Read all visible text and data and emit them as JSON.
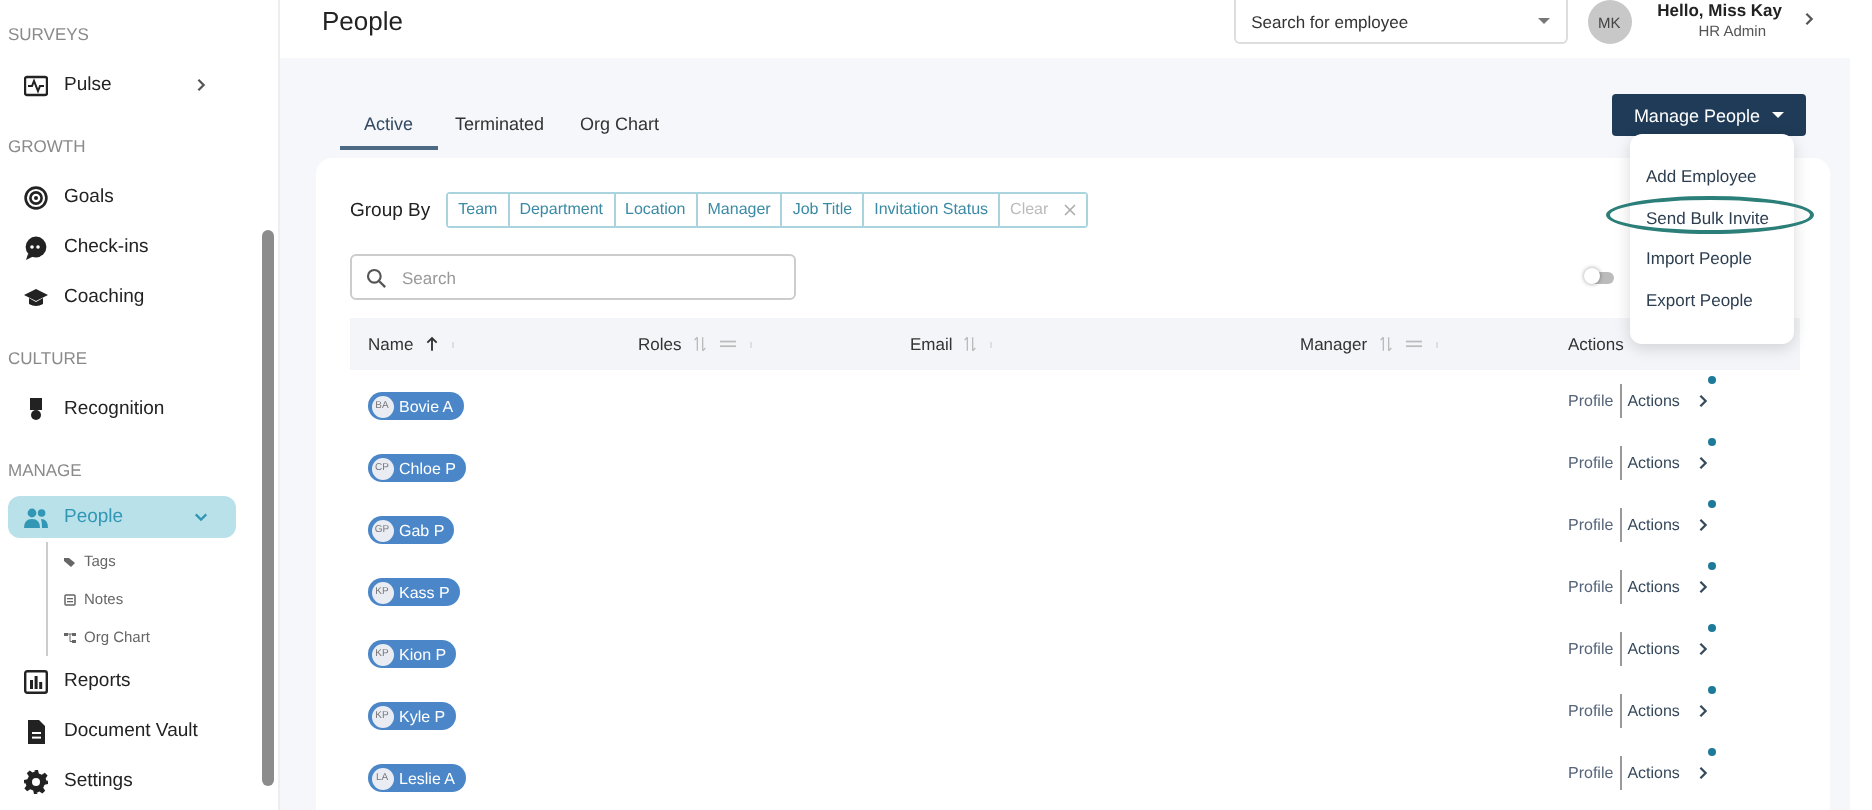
{
  "sidebar": {
    "sections": [
      {
        "heading": "SURVEYS",
        "items": [
          {
            "label": "Pulse",
            "selected": false,
            "expanded": false
          }
        ]
      },
      {
        "heading": "GROWTH",
        "items": [
          {
            "label": "Goals",
            "selected": false
          },
          {
            "label": "Check-ins",
            "selected": false
          },
          {
            "label": "Coaching",
            "selected": false
          }
        ]
      },
      {
        "heading": "CULTURE",
        "items": [
          {
            "label": "Recognition",
            "selected": false
          }
        ]
      },
      {
        "heading": "MANAGE",
        "items": [
          {
            "label": "People",
            "selected": true,
            "expanded": true,
            "children": [
              {
                "label": "Tags"
              },
              {
                "label": "Notes"
              },
              {
                "label": "Org Chart"
              }
            ]
          },
          {
            "label": "Reports",
            "selected": false
          },
          {
            "label": "Document Vault",
            "selected": false
          },
          {
            "label": "Settings",
            "selected": false
          }
        ]
      }
    ]
  },
  "header": {
    "title": "People",
    "employee_search": {
      "placeholder": "Search for employee"
    },
    "user": {
      "initials": "MK",
      "greeting": "Hello, Miss Kay",
      "role": "HR Admin"
    }
  },
  "tabs": [
    {
      "label": "Active",
      "selected": true
    },
    {
      "label": "Terminated",
      "selected": false
    },
    {
      "label": "Org Chart",
      "selected": false
    }
  ],
  "manage_button": {
    "label": "Manage People",
    "open": true
  },
  "manage_menu": [
    {
      "label": "Add Employee",
      "circled": false
    },
    {
      "label": "Send Bulk Invite",
      "circled": true
    },
    {
      "label": "Import People",
      "circled": false
    },
    {
      "label": "Export People",
      "circled": false
    }
  ],
  "group_by": {
    "label": "Group By",
    "options": [
      {
        "label": "Team",
        "disabled": false
      },
      {
        "label": "Department",
        "disabled": false
      },
      {
        "label": "Location",
        "disabled": false
      },
      {
        "label": "Manager",
        "disabled": false
      },
      {
        "label": "Job Title",
        "disabled": false
      },
      {
        "label": "Invitation Status",
        "disabled": false
      },
      {
        "label": "Clear",
        "disabled": true
      }
    ]
  },
  "search": {
    "placeholder": "Search"
  },
  "toggle": {
    "on": false
  },
  "table": {
    "columns": [
      {
        "label": "Name",
        "sortable": true,
        "sorted": true,
        "menu": true,
        "group": false
      },
      {
        "label": "Roles",
        "sortable": true,
        "sorted": false,
        "menu": true,
        "group": true
      },
      {
        "label": "Email",
        "sortable": true,
        "sorted": false,
        "menu": true,
        "group": false
      },
      {
        "label": "Manager",
        "sortable": true,
        "sorted": false,
        "menu": true,
        "group": true
      },
      {
        "label": "Actions",
        "sortable": false,
        "menu": false,
        "group": false
      }
    ],
    "rows": [
      {
        "initials": "BA",
        "name": "Bovie A",
        "profile": "Profile",
        "actions": "Actions",
        "notified": true
      },
      {
        "initials": "CP",
        "name": "Chloe P",
        "profile": "Profile",
        "actions": "Actions",
        "notified": true
      },
      {
        "initials": "GP",
        "name": "Gab P",
        "profile": "Profile",
        "actions": "Actions",
        "notified": true
      },
      {
        "initials": "KP",
        "name": "Kass P",
        "profile": "Profile",
        "actions": "Actions",
        "notified": true
      },
      {
        "initials": "KP",
        "name": "Kion P",
        "profile": "Profile",
        "actions": "Actions",
        "notified": true
      },
      {
        "initials": "KP",
        "name": "Kyle P",
        "profile": "Profile",
        "actions": "Actions",
        "notified": true
      },
      {
        "initials": "LA",
        "name": "Leslie A",
        "profile": "Profile",
        "actions": "Actions",
        "notified": true
      }
    ]
  }
}
